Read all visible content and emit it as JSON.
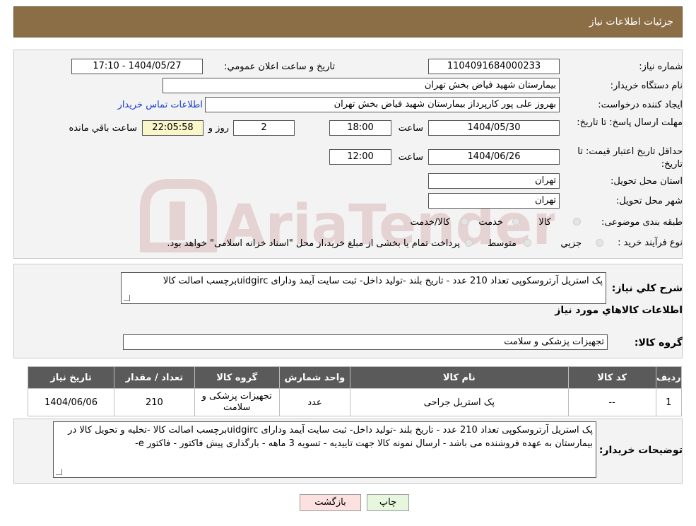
{
  "header": {
    "title": "جزئیات اطلاعات نیاز"
  },
  "form": {
    "need_number_label": "شماره نیاز:",
    "need_number": "1104091684000233",
    "announce_label": "تاریخ و ساعت اعلان عمومي:",
    "announce_value": "1404/05/27 - 17:10",
    "buyer_label": "نام دستگاه خريدار:",
    "buyer_value": "بیمارستان شهید فیاض بخش تهران",
    "creator_label": "ايجاد کننده درخواست:",
    "creator_value": "بهروز علی پور کارپرداز بیمارستان شهید فیاض بخش تهران",
    "contact_link": "اطلاعات تماس خريدار",
    "deadline_label": "مهلت ارسال پاسخ: تا تاريخ:",
    "deadline_date": "1404/05/30",
    "time_label": "ساعت",
    "deadline_time": "18:00",
    "days_value": "2",
    "days_label": "روز و",
    "remaining_time": "22:05:58",
    "remaining_label": "ساعت باقي مانده",
    "validity_label": "حداقل تاريخ اعتبار قيمت: تا تاريخ:",
    "validity_date": "1404/06/26",
    "validity_time": "12:00",
    "province_label": "استان محل تحويل:",
    "province_value": "تهران",
    "city_label": "شهر محل تحويل:",
    "city_value": "تهران",
    "category_label": "طبقه بندی موضوعی:",
    "category_options": [
      "کالا",
      "خدمت",
      "کالا/خدمت"
    ],
    "process_label": "نوع فرآيند خريد :",
    "process_options": [
      "جزيي",
      "متوسط"
    ],
    "process_note": "پرداخت تمام يا بخشی از مبلغ خريد،از محل \"اسناد خزانه اسلامی\" خواهد بود."
  },
  "summary": {
    "desc_label": "شرح کلي نياز:",
    "desc_value": "پک استریل آرتروسکوپی تعداد 210 عدد - تاریخ بلند -تولید داخل- ثبت سایت آیمد ودارای uidgircبرچسب اصالت کالا",
    "goods_info_title": "اطلاعات کالاهاي مورد نياز",
    "group_label": "گروه کالا:",
    "group_value": "تجهیزات پزشکی و سلامت"
  },
  "table": {
    "headers": [
      "رديف",
      "کد کالا",
      "نام کالا",
      "واحد شمارش",
      "گروه کالا",
      "تعداد / مقدار",
      "تاريخ نياز"
    ],
    "rows": [
      [
        "1",
        "--",
        "پک استریل جراحی",
        "عدد",
        "تجهیزات پزشکی و سلامت",
        "210",
        "1404/06/06"
      ]
    ]
  },
  "buyer_notes": {
    "label": "توضيحات خريدار:",
    "value": "پک استریل آرتروسکوپی تعداد 210 عدد - تاریخ بلند -تولید داخل- ثبت سایت آیمد ودارای uidgircبرچسب اصالت کالا -تخلیه و تحویل کالا در بیمارستان به عهده فروشنده می باشد - ارسال نمونه کالا جهت تاییدیه - تسویه 3 ماهه - بارگذاری پیش فاکتور - فاکتور e-"
  },
  "buttons": {
    "print": "چاپ",
    "back": "بازگشت"
  },
  "watermark": {
    "text": "AriaTender.neT"
  },
  "colors": {
    "header_bg": "#8b6e46",
    "table_header_bg": "#5a5a5a",
    "timer_bg": "#fbf6c9",
    "back_btn_bg": "#fde1e1",
    "print_btn_bg": "#e6f7de",
    "link": "#1a3fd0"
  }
}
